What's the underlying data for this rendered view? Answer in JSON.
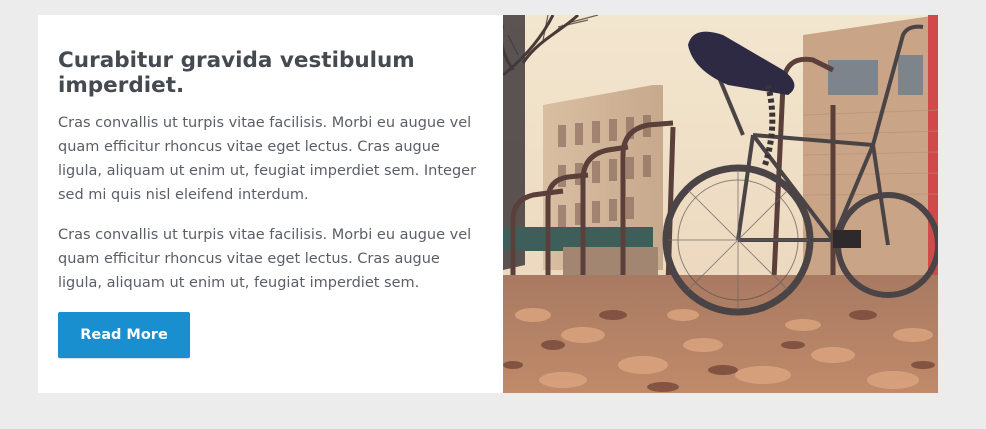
{
  "feature": {
    "title": "Curabitur gravida vestibulum imperdiet.",
    "paragraphs": [
      "Cras convallis ut turpis vitae facilisis. Morbi eu augue vel quam efficitur rhoncus vitae eget lectus. Cras augue ligula, aliquam ut enim ut, feugiat imperdiet sem. Integer sed mi quis nisl eleifend interdum.",
      "Cras convallis ut turpis vitae facilisis. Morbi eu augue vel quam efficitur rhoncus vitae eget lectus. Cras augue ligula, aliquam ut enim ut, feugiat imperdiet sem."
    ],
    "button_label": "Read More",
    "button_color": "#1a8fd0"
  },
  "image": {
    "subject": "bicycle-photo"
  }
}
